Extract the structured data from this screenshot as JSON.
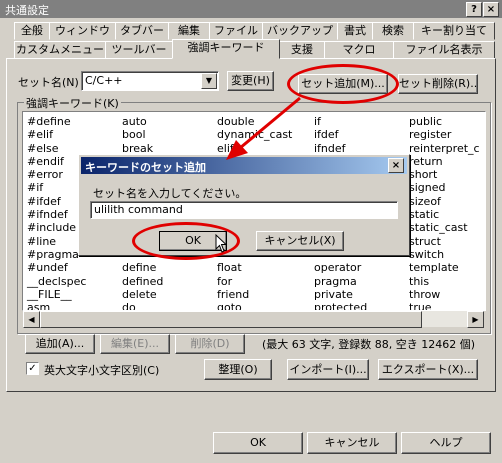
{
  "window": {
    "title": "共通設定"
  },
  "titlebar_buttons": {
    "help": "?",
    "close": "×"
  },
  "tabs_row1": [
    "全般",
    "ウィンドウ",
    "タブバー",
    "編集",
    "ファイル",
    "バックアップ",
    "書式",
    "検索",
    "キー割り当て"
  ],
  "tabs_row2": [
    "カスタムメニュー",
    "ツールバー",
    "強調キーワード",
    "支援",
    "マクロ",
    "ファイル名表示"
  ],
  "set_label": "セット名(N)",
  "set_value": "C/C++",
  "buttons": {
    "change": "変更(H)",
    "add_set": "セット追加(M)...",
    "delete_set": "セット削除(R)...",
    "add": "追加(A)...",
    "edit": "編集(E)...",
    "remove": "削除(D)",
    "organize": "整理(O)",
    "import": "インポート(I)...",
    "export": "エクスポート(X)...",
    "ok": "OK",
    "cancel": "キャンセル",
    "help": "ヘルプ"
  },
  "group_label": "強調キーワード(K)",
  "keywords": [
    [
      "#define",
      "#elif",
      "#else",
      "#endif",
      "#error",
      "#if",
      "#ifdef",
      "#ifndef",
      "#include",
      "#line",
      "#pragma",
      "#undef",
      "__declspec",
      "__FILE__",
      "asm"
    ],
    [
      "auto",
      "bool",
      "break",
      "",
      "",
      "",
      "",
      "",
      "",
      "",
      "",
      "define",
      "defined",
      "delete",
      "do"
    ],
    [
      "double",
      "dynamic_cast",
      "elif",
      "",
      "",
      "",
      "",
      "",
      "",
      "",
      "",
      "float",
      "for",
      "friend",
      "goto"
    ],
    [
      "if",
      "ifdef",
      "ifndef",
      "",
      "",
      "",
      "",
      "",
      "",
      "",
      "",
      "operator",
      "pragma",
      "private",
      "protected"
    ],
    [
      "public",
      "register",
      "reinterpret_c",
      "return",
      "short",
      "signed",
      "sizeof",
      "static",
      "static_cast",
      "struct",
      "switch",
      "template",
      "this",
      "throw",
      "true"
    ]
  ],
  "stats": "(最大 63 文字, 登録数 88, 空き 12462 個)",
  "case_checkbox": {
    "label": "英大文字小文字区別(C)",
    "checked": true,
    "mark": "✓"
  },
  "dialog": {
    "title": "キーワードのセット追加",
    "prompt": "セット名を入力してください。",
    "input_value": "ulilith command",
    "ok": "OK",
    "cancel": "キャンセル(X)",
    "close": "×"
  },
  "annotation_color": "#e00000"
}
